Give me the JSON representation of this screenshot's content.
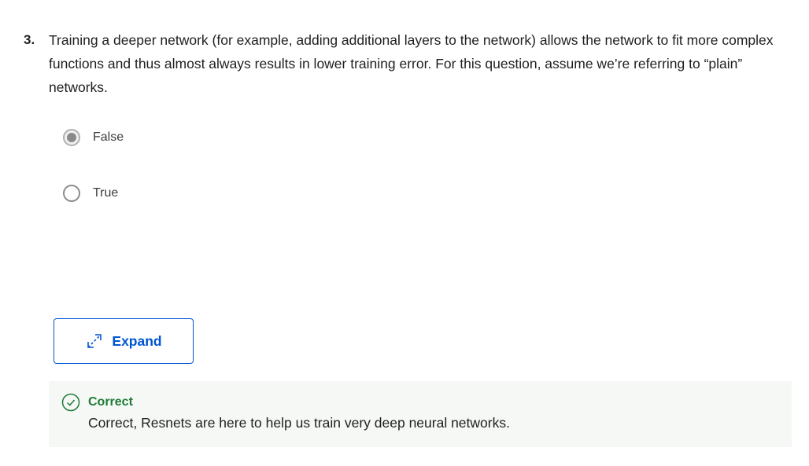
{
  "question": {
    "number": "3.",
    "text": "Training a deeper network (for example, adding additional layers to the network) allows the network to fit more complex functions and thus almost always results in lower training error. For this question, assume we’re referring to “plain” networks."
  },
  "options": [
    {
      "label": "False",
      "selected": true
    },
    {
      "label": "True",
      "selected": false
    }
  ],
  "expand": {
    "label": "Expand",
    "icon": "expand-arrows-icon"
  },
  "feedback": {
    "status": "Correct",
    "icon": "check-circle-icon",
    "message": "Correct, Resnets are here to help us train very deep neural networks."
  },
  "colors": {
    "accent": "#0056d2",
    "success": "#1e7a34",
    "feedback_bg": "#f5f8f5"
  }
}
